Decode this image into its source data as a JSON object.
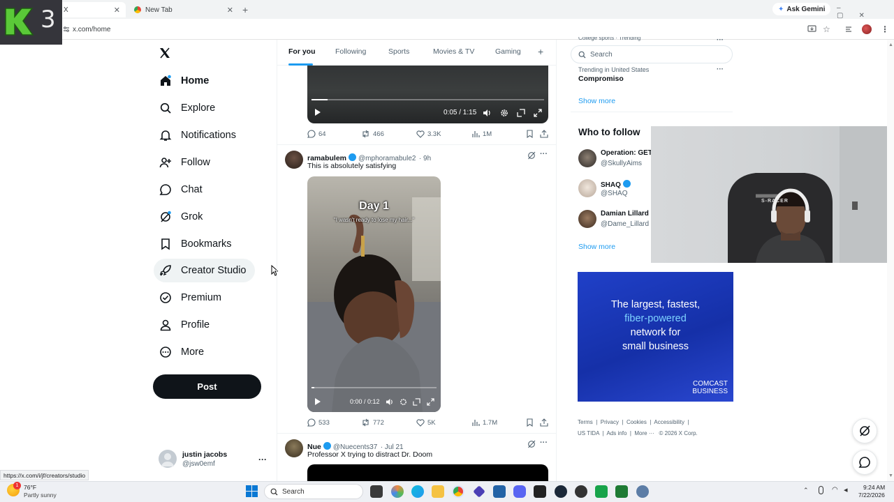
{
  "browser": {
    "tabs": [
      {
        "label": "Home / X"
      },
      {
        "label": "New Tab"
      }
    ],
    "url": "x.com/home",
    "gemini_label": "Ask Gemini",
    "status_url": "https://x.com/i/jf/creators/studio"
  },
  "overlay_logo": {
    "digit": "3"
  },
  "nav": {
    "items": [
      {
        "label": "Home",
        "icon": "home-icon"
      },
      {
        "label": "Explore",
        "icon": "search-icon"
      },
      {
        "label": "Notifications",
        "icon": "bell-icon"
      },
      {
        "label": "Follow",
        "icon": "person-add-icon"
      },
      {
        "label": "Chat",
        "icon": "chat-bubble-icon"
      },
      {
        "label": "Grok",
        "icon": "grok-icon"
      },
      {
        "label": "Bookmarks",
        "icon": "bookmark-icon"
      },
      {
        "label": "Creator Studio",
        "icon": "rocket-icon"
      },
      {
        "label": "Premium",
        "icon": "verified-circle-icon"
      },
      {
        "label": "Profile",
        "icon": "person-icon"
      },
      {
        "label": "More",
        "icon": "more-circle-icon"
      }
    ],
    "post_label": "Post",
    "account": {
      "name": "justin jacobs",
      "handle": "@jsw0emf",
      "more": "···"
    }
  },
  "feed": {
    "tabs": [
      "For you",
      "Following",
      "Sports",
      "Movies & TV",
      "Gaming"
    ],
    "add_tab": "+",
    "post0": {
      "video_time": "0:05 / 1:15",
      "progress": 0.07,
      "replies": "64",
      "reposts": "466",
      "likes": "3.3K",
      "views": "1M"
    },
    "post1": {
      "name": "ramabulem",
      "handle": "@mphoramabule2",
      "time": "· 9h",
      "text": "This is absolutely satisfying",
      "overlay_title": "Day 1",
      "overlay_caption": "\"I wasn't ready to lose my hair...\"",
      "video_time": "0:00 / 0:12",
      "progress": 0.02,
      "replies": "533",
      "reposts": "772",
      "likes": "5K",
      "views": "1.7M"
    },
    "post2": {
      "name": "Nue",
      "handle": "@Nuecents37",
      "time": "· Jul 21",
      "text": "Professor X trying to distract Dr. Doom"
    }
  },
  "sidebar": {
    "search_placeholder": "Search",
    "trending_top_cut": "College sports · Trending",
    "trend": {
      "context": "Trending in United States",
      "title": "Compromiso"
    },
    "show_more": "Show more",
    "who_to_follow": "Who to follow",
    "follow": [
      {
        "name": "Operation: GET",
        "handle": "@SkullyAims"
      },
      {
        "name": "SHAQ",
        "handle": "@SHAQ"
      },
      {
        "name": "Damian Lillard",
        "handle": "@Dame_Lillard"
      }
    ],
    "ad": {
      "line1": "The largest, fastest,",
      "line2": "fiber-powered",
      "line3": "network for",
      "line4": "small business",
      "brand1": "COMCAST",
      "brand2": "BUSINESS"
    },
    "footer": {
      "links": [
        "Terms",
        "Privacy",
        "Cookies",
        "Accessibility",
        "US TIDA",
        "Ads info",
        "More ···"
      ],
      "copyright": "© 2026 X Corp."
    }
  },
  "webcam": {
    "chair_text": "S-RACER"
  },
  "taskbar": {
    "weather_temp": "76°F",
    "weather_desc": "Partly sunny",
    "search_label": "Search",
    "time": "9:24 AM",
    "date": "7/22/2026",
    "badge": "1"
  },
  "colors": {
    "accent": "#1d9bf0",
    "text": "#0f1419",
    "muted": "#536471"
  }
}
